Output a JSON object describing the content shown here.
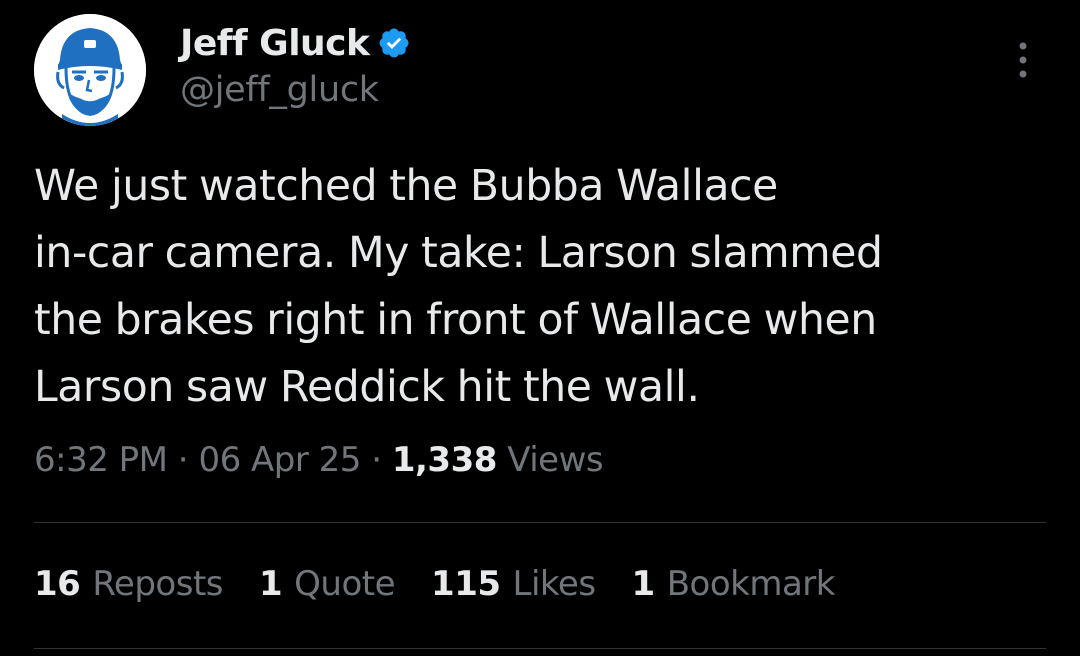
{
  "author": {
    "display_name": "Jeff Gluck",
    "handle": "@jeff_gluck",
    "verified_icon": "verified-badge-icon",
    "avatar_icon": "cartoon-avatar-icon"
  },
  "tweet": {
    "lines": [
      "We just watched the Bubba Wallace",
      "in-car camera. My take: Larson slammed",
      "the brakes right in front of Wallace when",
      "Larson saw Reddick hit the wall."
    ]
  },
  "meta": {
    "time": "6:32 PM",
    "sep1": " · ",
    "date": "06 Apr 25",
    "sep2": " · ",
    "views_count": "1,338",
    "views_label": " Views"
  },
  "stats": [
    {
      "count": "16",
      "label": "Reposts"
    },
    {
      "count": "1",
      "label": "Quote"
    },
    {
      "count": "115",
      "label": "Likes"
    },
    {
      "count": "1",
      "label": "Bookmark"
    }
  ],
  "menu_icon": "more-vertical-icon",
  "colors": {
    "background": "#000000",
    "primary_text": "#e7e9ea",
    "secondary_text": "#71767b",
    "verified_blue": "#1d9bf0",
    "avatar_blue": "#1f70c1",
    "divider": "#2f3336"
  }
}
